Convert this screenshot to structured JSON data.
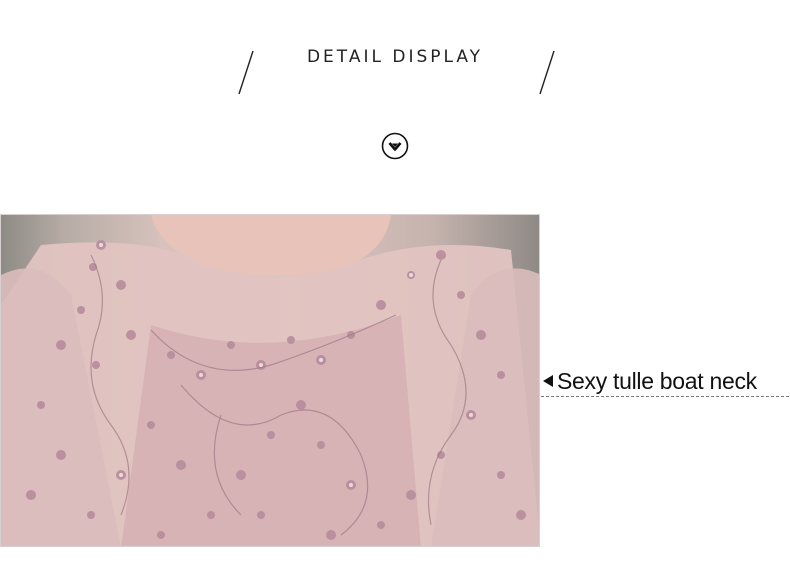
{
  "header": {
    "title": "DETAIL DISPLAY",
    "scroll_icon": "chevron-down-circle-icon"
  },
  "detail": {
    "image_subject": "lace-dress-neckline-photo",
    "callout_label": "Sexy tulle boat neck",
    "callout_icon": "left-pointer-icon"
  },
  "colors": {
    "text": "#111111",
    "dress": "#d8b7b8",
    "lace": "#b98c9a"
  }
}
